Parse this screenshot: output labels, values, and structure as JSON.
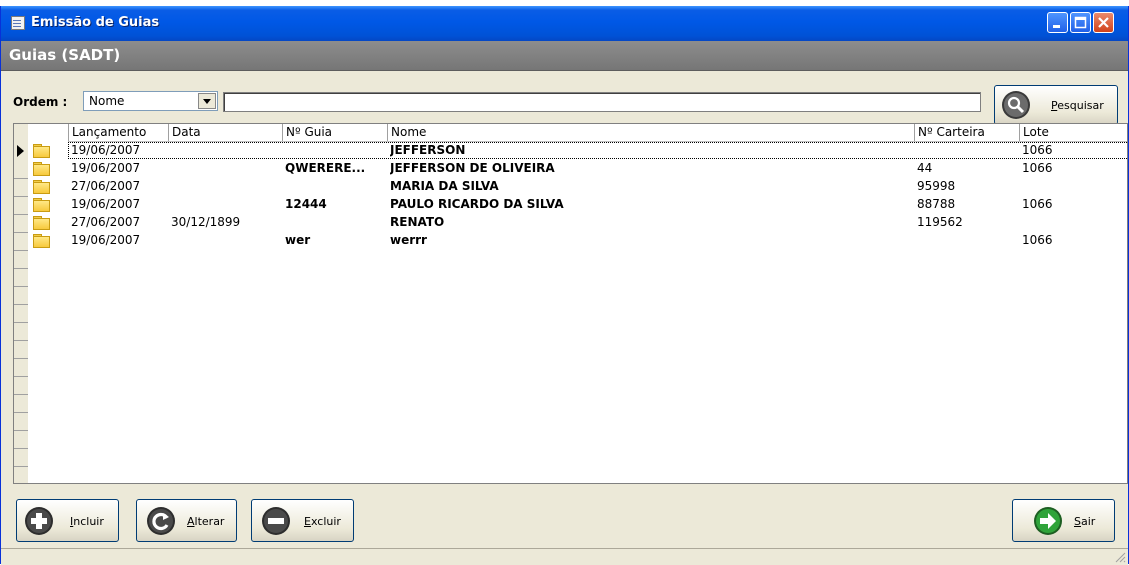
{
  "window": {
    "title": "Emissão de Guias",
    "header_title": "Guias (SADT)"
  },
  "search": {
    "ordem_label": "Ordem :",
    "order_value": "Nome",
    "query": "",
    "button_label_underlined": "P",
    "button_label_rest": "esquisar",
    "button_icon": "magnifier-icon"
  },
  "grid": {
    "columns": [
      "Lançamento",
      "Data",
      "Nº Guia",
      "Nome",
      "Nº Carteira",
      "Lote"
    ],
    "rows": [
      {
        "lancamento": "19/06/2007",
        "data": "",
        "guia": "",
        "nome": "JEFFERSON",
        "carteira": "",
        "lote": "1066",
        "selected": true
      },
      {
        "lancamento": "19/06/2007",
        "data": "",
        "guia": "QWERERE...",
        "nome": "JEFFERSON DE OLIVEIRA",
        "carteira": "44",
        "lote": "1066",
        "selected": false
      },
      {
        "lancamento": "27/06/2007",
        "data": "",
        "guia": "",
        "nome": "MARIA DA SILVA",
        "carteira": "95998",
        "lote": "",
        "selected": false
      },
      {
        "lancamento": "19/06/2007",
        "data": "",
        "guia": "12444",
        "nome": "PAULO RICARDO DA SILVA",
        "carteira": "88788",
        "lote": "1066",
        "selected": false
      },
      {
        "lancamento": "27/06/2007",
        "data": "30/12/1899",
        "guia": "",
        "nome": "RENATO",
        "carteira": "119562",
        "lote": "",
        "selected": false
      },
      {
        "lancamento": "19/06/2007",
        "data": "",
        "guia": "wer",
        "nome": "werrr",
        "carteira": "",
        "lote": "1066",
        "selected": false
      }
    ]
  },
  "buttons": {
    "incluir": {
      "u": "I",
      "rest": "ncluir",
      "icon": "plus-circle-icon"
    },
    "alterar": {
      "u": "A",
      "rest": "lterar",
      "icon": "refresh-circle-icon"
    },
    "excluir": {
      "u": "E",
      "rest": "xcluir",
      "icon": "minus-circle-icon"
    },
    "sair": {
      "u": "S",
      "rest": "air",
      "icon": "exit-arrow-icon"
    }
  },
  "colors": {
    "titlebar": "#0058e6",
    "header_band": "#808080",
    "window_bg": "#ece9d8",
    "exit_icon": "#2fa33a"
  }
}
